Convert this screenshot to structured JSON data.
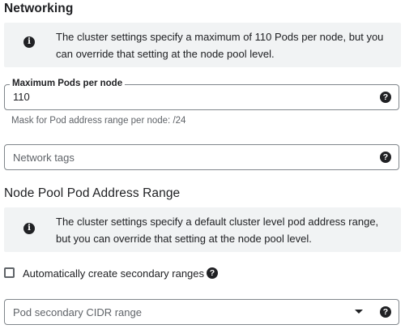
{
  "networking": {
    "title": "Networking",
    "info_icon_glyph": "i",
    "info_text": "The cluster settings specify a maximum of 110 Pods per node, but you can override that setting at the node pool level.",
    "max_pods": {
      "label": "Maximum Pods per node",
      "value": "110",
      "help_glyph": "?",
      "hint": "Mask for Pod address range per node: /24"
    },
    "network_tags": {
      "placeholder": "Network tags",
      "help_glyph": "?"
    }
  },
  "pod_address_range": {
    "title": "Node Pool Pod Address Range",
    "info_icon_glyph": "i",
    "info_text": "The cluster settings specify a default cluster level pod address range, but you can override that setting at the node pool level.",
    "auto_secondary": {
      "label": "Automatically create secondary ranges",
      "checked": false,
      "help_glyph": "?"
    },
    "cidr_dropdown": {
      "placeholder": "Pod secondary CIDR range",
      "help_glyph": "?"
    }
  },
  "icons": {
    "info": "info-icon",
    "help": "help-icon",
    "dropdown": "chevron-down-icon",
    "checkbox": "checkbox-unchecked"
  }
}
